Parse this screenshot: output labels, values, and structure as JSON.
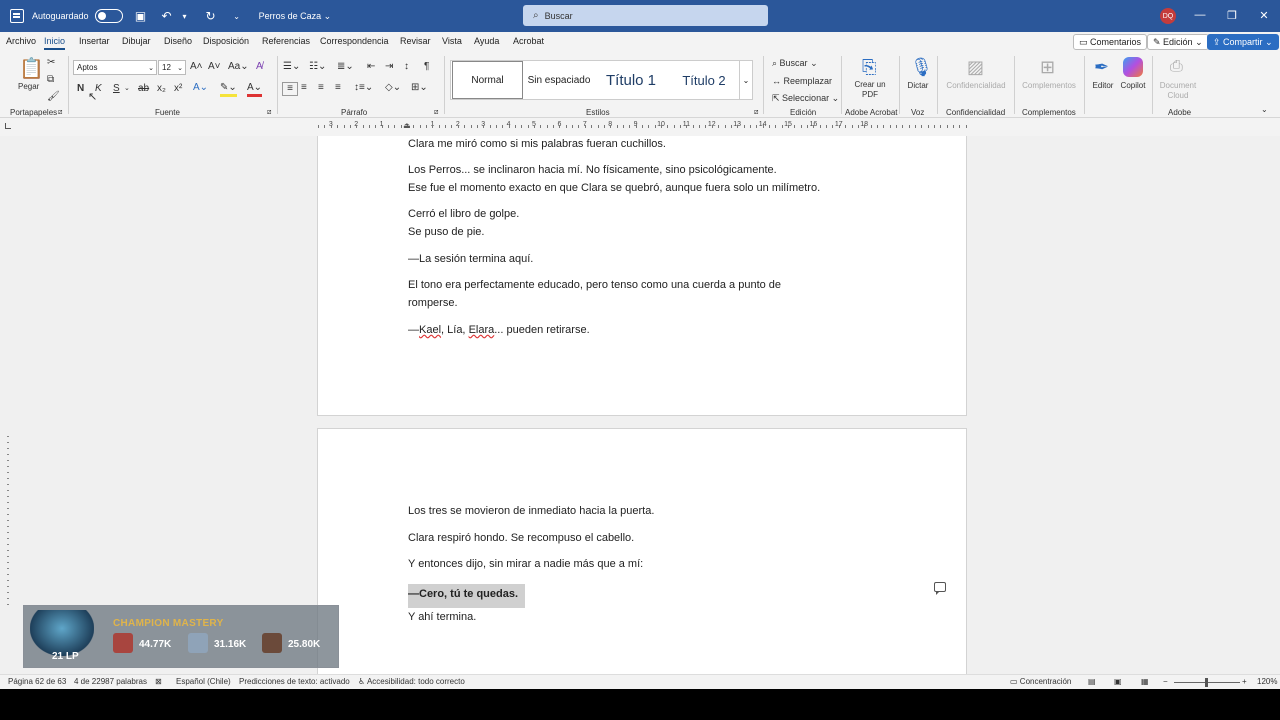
{
  "titlebar": {
    "autosave_label": "Autoguardado",
    "doc_title": "Perros de Caza",
    "search_placeholder": "Buscar",
    "user_initials": "DQ"
  },
  "menu": {
    "tabs": [
      "Archivo",
      "Inicio",
      "Insertar",
      "Dibujar",
      "Diseño",
      "Disposición",
      "Referencias",
      "Correspondencia",
      "Revisar",
      "Vista",
      "Ayuda",
      "Acrobat"
    ],
    "active": "Inicio",
    "comments_label": "Comentarios",
    "edit_label": "Edición",
    "share_label": "Compartir"
  },
  "ribbon": {
    "paste_label": "Pegar",
    "font_name": "Aptos",
    "font_size": "12",
    "styles": [
      "Normal",
      "Sin espaciado",
      "Título 1",
      "Título 2"
    ],
    "find_label": "Buscar",
    "replace_label": "Reemplazar",
    "select_label": "Seleccionar",
    "create_pdf_label": "Crear un PDF",
    "dictate_label": "Dictar",
    "confidentiality_label": "Confidencialidad",
    "addins_label": "Complementos",
    "editor_label": "Editor",
    "copilot_label": "Copilot",
    "doc_cloud_label": "Document Cloud",
    "groups": {
      "clipboard": "Portapapeles",
      "font": "Fuente",
      "paragraph": "Párrafo",
      "styles": "Estilos",
      "editing": "Edición",
      "acrobat": "Adobe Acrobat",
      "voice": "Voz",
      "confidentiality": "Confidencialidad",
      "addins": "Complementos",
      "adobe": "Adobe"
    }
  },
  "ruler_numbers": [
    "3",
    "2",
    "1",
    "1",
    "2",
    "3",
    "4",
    "5",
    "6",
    "7",
    "8",
    "9",
    "10",
    "11",
    "12",
    "13",
    "14",
    "15",
    "16",
    "17",
    "18"
  ],
  "page1": {
    "lines": [
      "Clara me miró como si mis palabras fueran cuchillos.",
      "Los Perros... se inclinaron hacia mí. No físicamente, sino psicológicamente.",
      "Ese fue el momento exacto en que Clara se quebró, aunque fuera solo un milímetro.",
      "Cerró el libro de golpe.",
      "Se puso de pie.",
      "—La sesión termina aquí.",
      "El tono era perfectamente educado, pero tenso como una cuerda a punto de",
      "romperse."
    ],
    "last_line": {
      "dash": "—",
      "name1": "Kael",
      "sep1": ", Lía, ",
      "name2": "Elara",
      "rest": "... pueden retirarse."
    }
  },
  "page2": {
    "lines": [
      "Los tres se movieron de inmediato hacia la puerta.",
      "Clara respiró hondo. Se recompuso el cabello.",
      "Y entonces dijo, sin mirar a nadie más que a mí:",
      "—Cero, tú te quedas.",
      "Y ahí termina."
    ]
  },
  "overlay": {
    "title": "CHAMPION MASTERY",
    "lp": "21 LP",
    "champions": [
      {
        "value": "44.77K",
        "color": "#a8453f"
      },
      {
        "value": "31.16K",
        "color": "#8fa3b8"
      },
      {
        "value": "25.80K",
        "color": "#6b4a3a"
      }
    ]
  },
  "status": {
    "page": "Página 62 de 63",
    "words": "4 de 22987 palabras",
    "language": "Español (Chile)",
    "predictions": "Predicciones de texto: activado",
    "accessibility": "Accesibilidad: todo correcto",
    "focus": "Concentración",
    "zoom": "120%"
  }
}
